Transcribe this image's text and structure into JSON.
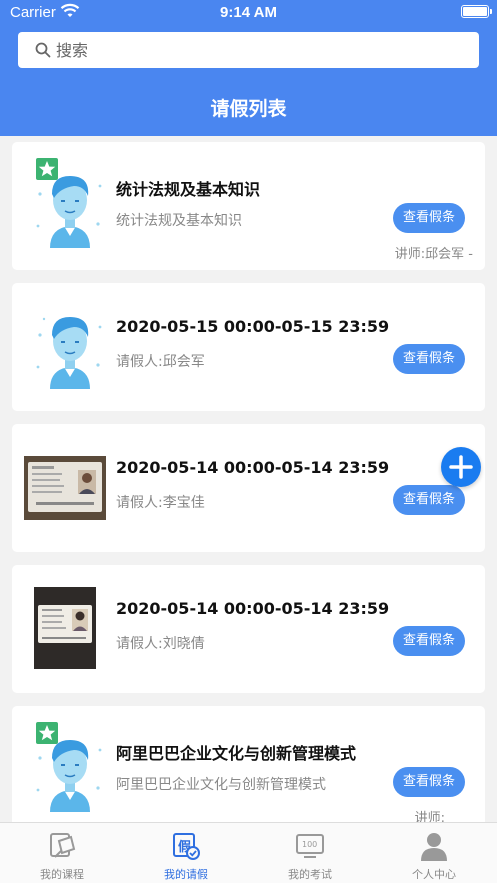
{
  "status": {
    "carrier": "Carrier",
    "time": "9:14 AM"
  },
  "search": {
    "placeholder": "搜索"
  },
  "header": {
    "title": "请假列表"
  },
  "items": [
    {
      "title": "统计法规及基本知识",
      "subtitle": "统计法规及基本知识",
      "button": "查看假条",
      "teacher": "讲师:邱会军 -",
      "thumb": "avatar-icon",
      "starred": true
    },
    {
      "title": "2020-05-15 00:00-05-15 23:59",
      "subtitle": "请假人:邱会军",
      "button": "查看假条",
      "thumb": "avatar-icon",
      "starred": false
    },
    {
      "title": "2020-05-14 00:00-05-14 23:59",
      "subtitle": "请假人:李宝佳",
      "button": "查看假条",
      "thumb": "id-card-photo",
      "starred": false
    },
    {
      "title": "2020-05-14 00:00-05-14 23:59",
      "subtitle": "请假人:刘晓倩",
      "button": "查看假条",
      "thumb": "id-card-photo",
      "starred": false
    },
    {
      "title": "阿里巴巴企业文化与创新管理模式",
      "subtitle": "阿里巴巴企业文化与创新管理模式",
      "button": "查看假条",
      "teacher": "讲师:",
      "thumb": "avatar-icon",
      "starred": true
    }
  ],
  "tabs": [
    {
      "label": "我的课程",
      "icon": "course-icon"
    },
    {
      "label": "我的请假",
      "icon": "leave-icon",
      "active": true
    },
    {
      "label": "我的考试",
      "icon": "exam-icon"
    },
    {
      "label": "个人中心",
      "icon": "profile-icon"
    }
  ],
  "colors": {
    "primary": "#4a86f0",
    "button": "#4a8ff0",
    "fab": "#1a7cf0",
    "star": "#3cb371"
  }
}
